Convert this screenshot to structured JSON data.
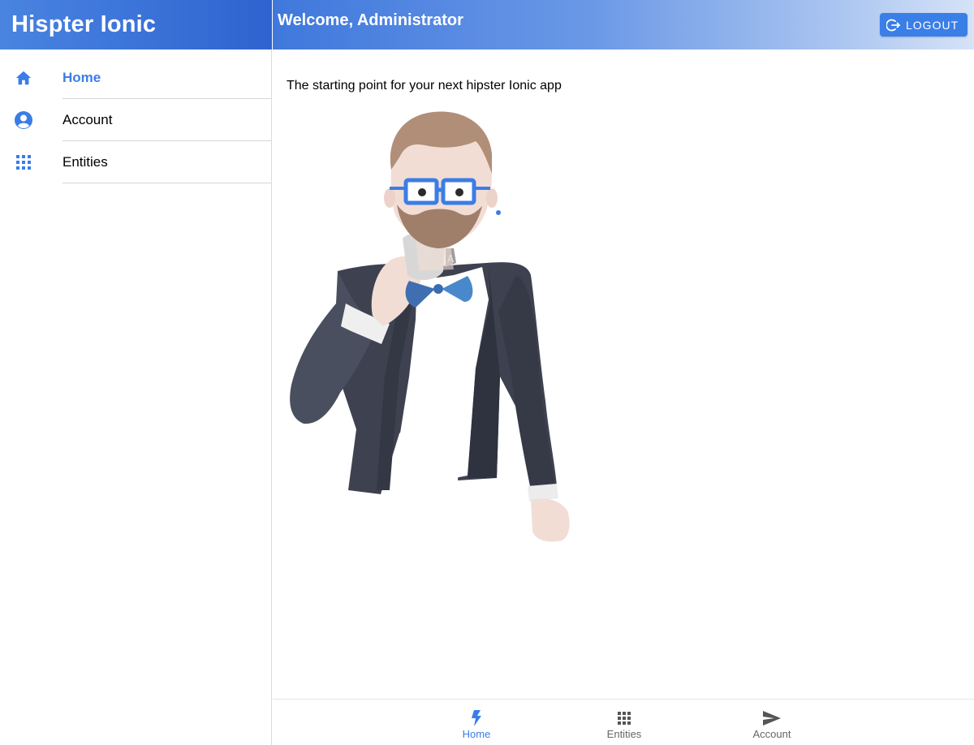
{
  "sidebar": {
    "title": "Hispter Ionic",
    "items": [
      {
        "label": "Home",
        "icon": "home-icon",
        "active": true
      },
      {
        "label": "Account",
        "icon": "person-circle-icon",
        "active": false
      },
      {
        "label": "Entities",
        "icon": "apps-grid-icon",
        "active": false
      }
    ]
  },
  "header": {
    "welcome": "Welcome, Administrator",
    "logout_label": "LOGOUT",
    "logout_icon": "log-out-icon"
  },
  "main": {
    "intro": "The starting point for your next hipster Ionic app",
    "illustration": "hipster-mascot-illustration"
  },
  "tabs": [
    {
      "label": "Home",
      "icon": "flash-icon",
      "active": true
    },
    {
      "label": "Entities",
      "icon": "apps-grid-icon",
      "active": false
    },
    {
      "label": "Account",
      "icon": "send-icon",
      "active": false
    }
  ],
  "colors": {
    "accent": "#3b7de6",
    "header_gradient_start": "#3f78dc",
    "header_gradient_end": "#d6e3f8",
    "text": "#000000",
    "muted": "#666666"
  }
}
